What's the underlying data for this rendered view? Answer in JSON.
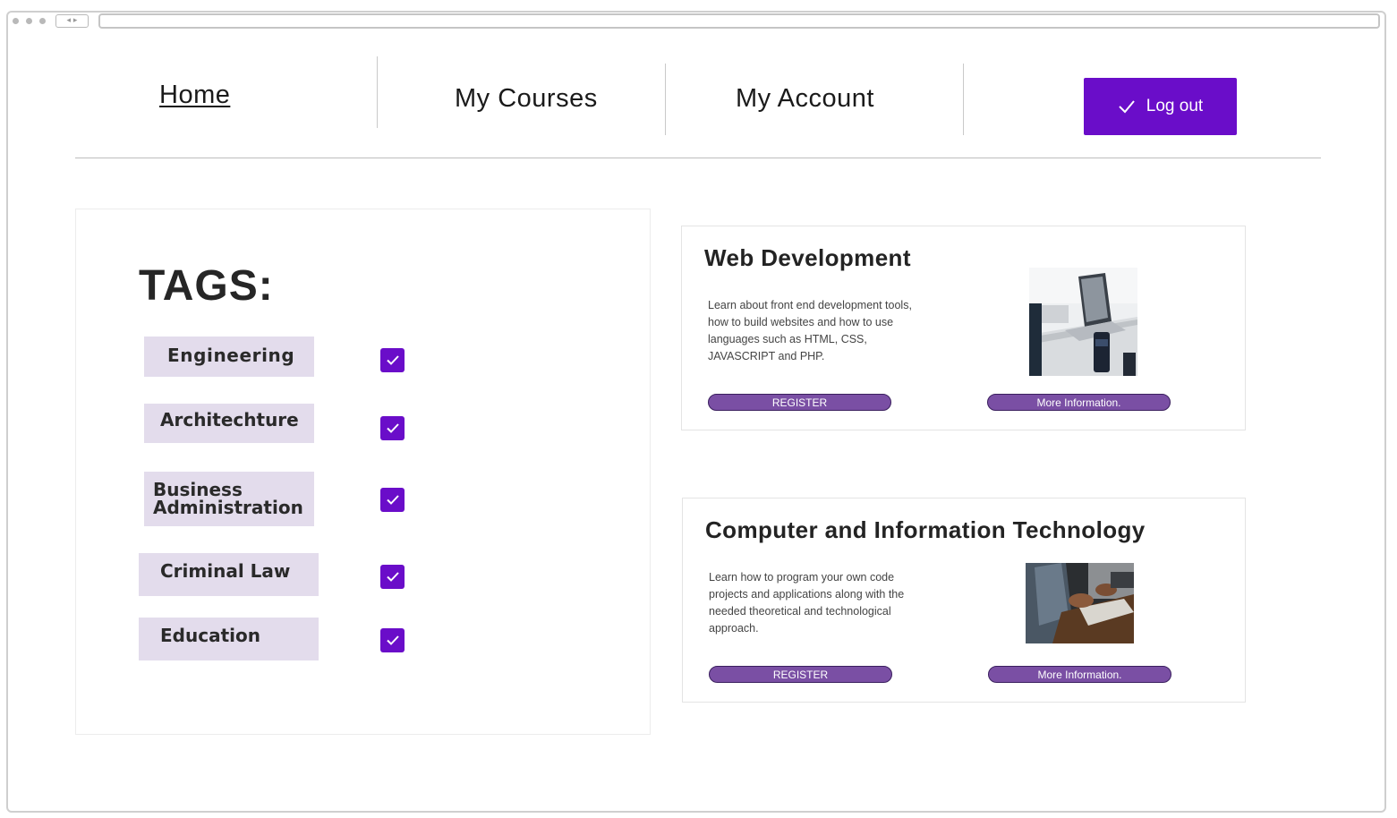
{
  "nav": {
    "home": "Home",
    "courses": "My Courses",
    "account": "My Account",
    "logout": "Log out"
  },
  "tags": {
    "title": "TAGS:",
    "items": [
      {
        "label": "Engineering",
        "checked": true
      },
      {
        "label": "Architechture",
        "checked": true
      },
      {
        "label_line1": "Business",
        "label_line2": "Administration",
        "checked": true
      },
      {
        "label": "Criminal Law",
        "checked": true
      },
      {
        "label": "Education",
        "checked": true
      }
    ]
  },
  "courses": [
    {
      "title": "Web Development",
      "desc_lines": [
        "Learn about front end development tools,",
        "how to build websites and how to use",
        "languages such as HTML, CSS,",
        "JAVASCRIPT and PHP."
      ],
      "register": "REGISTER",
      "more": "More Information."
    },
    {
      "title": "Computer and Information Technology",
      "desc_lines": [
        "Learn how to program your own code",
        "projects and applications along with the",
        "needed theoretical and technological",
        "approach."
      ],
      "register": "REGISTER",
      "more": "More Information."
    }
  ],
  "colors": {
    "accent": "#6a0dc9",
    "tag_bg": "#e3dcec",
    "pill": "#7a4fa4"
  }
}
